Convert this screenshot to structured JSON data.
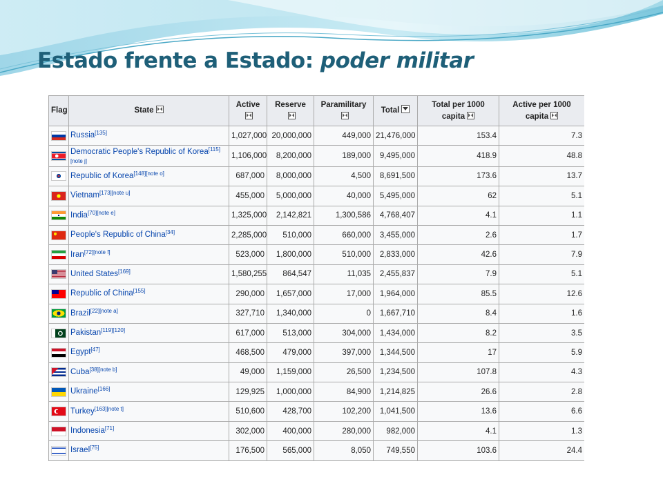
{
  "slide": {
    "title_main": "Estado frente a Estado: ",
    "title_italic": "poder militar"
  },
  "table": {
    "headers": {
      "flag": "Flag",
      "state": "State",
      "active": "Active",
      "reserve": "Reserve",
      "paramilitary": "Paramilitary",
      "total": "Total",
      "total_per_1000_line1": "Total per 1000",
      "total_per_1000_line2": "capita",
      "active_per_1000_line1": "Active per 1000",
      "active_per_1000_line2": "capita"
    },
    "rows": [
      {
        "flag": "russia-flag",
        "state": "Russia",
        "ref": "[135]",
        "ref2": "",
        "active": "1,027,000",
        "reserve": "20,000,000",
        "paramilitary": "449,000",
        "total": "21,476,000",
        "total_per_1000": "153.4",
        "active_per_1000": "7.3"
      },
      {
        "flag": "north-korea-flag",
        "state": "Democratic People's Republic of Korea",
        "ref": "[115]",
        "ref2": "[note j]",
        "active": "1,106,000",
        "reserve": "8,200,000",
        "paramilitary": "189,000",
        "total": "9,495,000",
        "total_per_1000": "418.9",
        "active_per_1000": "48.8"
      },
      {
        "flag": "south-korea-flag",
        "state": "Republic of Korea",
        "ref": "[148][note o]",
        "ref2": "",
        "active": "687,000",
        "reserve": "8,000,000",
        "paramilitary": "4,500",
        "total": "8,691,500",
        "total_per_1000": "173.6",
        "active_per_1000": "13.7"
      },
      {
        "flag": "vietnam-flag",
        "state": "Vietnam",
        "ref": "[173][note u]",
        "ref2": "",
        "active": "455,000",
        "reserve": "5,000,000",
        "paramilitary": "40,000",
        "total": "5,495,000",
        "total_per_1000": "62",
        "active_per_1000": "5.1"
      },
      {
        "flag": "india-flag",
        "state": "India",
        "ref": "[70][note e]",
        "ref2": "",
        "active": "1,325,000",
        "reserve": "2,142,821",
        "paramilitary": "1,300,586",
        "total": "4,768,407",
        "total_per_1000": "4.1",
        "active_per_1000": "1.1"
      },
      {
        "flag": "china-flag",
        "state": "People's Republic of China",
        "ref": "[34]",
        "ref2": "",
        "active": "2,285,000",
        "reserve": "510,000",
        "paramilitary": "660,000",
        "total": "3,455,000",
        "total_per_1000": "2.6",
        "active_per_1000": "1.7"
      },
      {
        "flag": "iran-flag",
        "state": "Iran",
        "ref": "[72][note f]",
        "ref2": "",
        "active": "523,000",
        "reserve": "1,800,000",
        "paramilitary": "510,000",
        "total": "2,833,000",
        "total_per_1000": "42.6",
        "active_per_1000": "7.9"
      },
      {
        "flag": "usa-flag",
        "state": "United States",
        "ref": "[169]",
        "ref2": "",
        "active": "1,580,255",
        "reserve": "864,547",
        "paramilitary": "11,035",
        "total": "2,455,837",
        "total_per_1000": "7.9",
        "active_per_1000": "5.1"
      },
      {
        "flag": "taiwan-flag",
        "state": "Republic of China",
        "ref": "[155]",
        "ref2": "",
        "active": "290,000",
        "reserve": "1,657,000",
        "paramilitary": "17,000",
        "total": "1,964,000",
        "total_per_1000": "85.5",
        "active_per_1000": "12.6"
      },
      {
        "flag": "brazil-flag",
        "state": "Brazil",
        "ref": "[22][note a]",
        "ref2": "",
        "active": "327,710",
        "reserve": "1,340,000",
        "paramilitary": "0",
        "total": "1,667,710",
        "total_per_1000": "8.4",
        "active_per_1000": "1.6"
      },
      {
        "flag": "pakistan-flag",
        "state": "Pakistan",
        "ref": "[119][120]",
        "ref2": "",
        "active": "617,000",
        "reserve": "513,000",
        "paramilitary": "304,000",
        "total": "1,434,000",
        "total_per_1000": "8.2",
        "active_per_1000": "3.5"
      },
      {
        "flag": "egypt-flag",
        "state": "Egypt",
        "ref": "[47]",
        "ref2": "",
        "active": "468,500",
        "reserve": "479,000",
        "paramilitary": "397,000",
        "total": "1,344,500",
        "total_per_1000": "17",
        "active_per_1000": "5.9"
      },
      {
        "flag": "cuba-flag",
        "state": "Cuba",
        "ref": "[38][note b]",
        "ref2": "",
        "active": "49,000",
        "reserve": "1,159,000",
        "paramilitary": "26,500",
        "total": "1,234,500",
        "total_per_1000": "107.8",
        "active_per_1000": "4.3"
      },
      {
        "flag": "ukraine-flag",
        "state": "Ukraine",
        "ref": "[166]",
        "ref2": "",
        "active": "129,925",
        "reserve": "1,000,000",
        "paramilitary": "84,900",
        "total": "1,214,825",
        "total_per_1000": "26.6",
        "active_per_1000": "2.8"
      },
      {
        "flag": "turkey-flag",
        "state": "Turkey",
        "ref": "[163][note t]",
        "ref2": "",
        "active": "510,600",
        "reserve": "428,700",
        "paramilitary": "102,200",
        "total": "1,041,500",
        "total_per_1000": "13.6",
        "active_per_1000": "6.6"
      },
      {
        "flag": "indonesia-flag",
        "state": "Indonesia",
        "ref": "[71]",
        "ref2": "",
        "active": "302,000",
        "reserve": "400,000",
        "paramilitary": "280,000",
        "total": "982,000",
        "total_per_1000": "4.1",
        "active_per_1000": "1.3"
      },
      {
        "flag": "israel-flag",
        "state": "Israel",
        "ref": "[75]",
        "ref2": "",
        "active": "176,500",
        "reserve": "565,000",
        "paramilitary": "8,050",
        "total": "749,550",
        "total_per_1000": "103.6",
        "active_per_1000": "24.4"
      }
    ]
  }
}
